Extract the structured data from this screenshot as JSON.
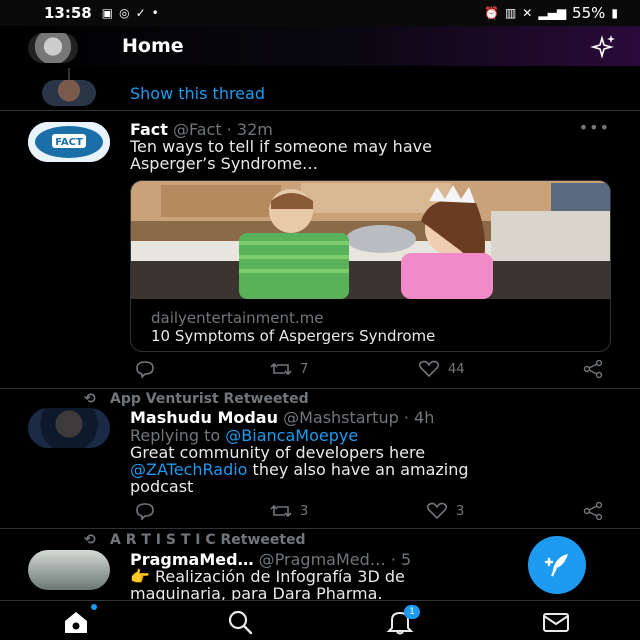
{
  "status_bar": {
    "time": "13:58",
    "battery": "55%",
    "icons_left": [
      "gallery-icon",
      "whatsapp-icon",
      "check-icon",
      "dot-icon"
    ],
    "icons_right": [
      "alarm-icon",
      "vibrate-icon",
      "mute-icon",
      "signal-icon",
      "battery-icon"
    ]
  },
  "header": {
    "title": "Home",
    "sparkle_icon": "sparkle-icon"
  },
  "thread": {
    "link_label": "Show this thread"
  },
  "tweets": [
    {
      "name": "Fact",
      "handle": "@Fact",
      "time": "· 32m",
      "text_line1": "Ten ways to tell if someone may have",
      "text_line2": "Asperger’s Syndrome…",
      "card": {
        "domain": "dailyentertainment.me",
        "title": "10 Symptoms of Aspergers Syndrome"
      },
      "retweets": "7",
      "likes": "44"
    },
    {
      "retweeted_by": "App Venturist Retweeted",
      "name": "Mashudu Modau",
      "handle": "@Mashstartup",
      "time": "· 4h",
      "replying_prefix": "Replying to",
      "replying_to": "@BiancaMoepye",
      "text_line1": "Great community of developers here",
      "mention": "@ZATechRadio",
      "text_line2_rest": " they also have an amazing",
      "text_line3": "podcast",
      "retweets": "3",
      "likes": "3"
    },
    {
      "retweeted_by": "A R T I S T I C Retweeted",
      "name": "PragmaMed…",
      "handle": "@PragmaMed…",
      "time": "· 5",
      "emoji": "👉",
      "text_line1": " Realización de Infografía 3D de",
      "text_line2": "maquinaria, para Dara Pharma."
    }
  ],
  "bottom_nav": {
    "notifications_badge": "1",
    "items": [
      "home-icon",
      "search-icon",
      "notifications-icon",
      "messages-icon"
    ]
  },
  "colors": {
    "accent": "#1d9bf0",
    "background": "#000000",
    "muted": "#71767b"
  }
}
